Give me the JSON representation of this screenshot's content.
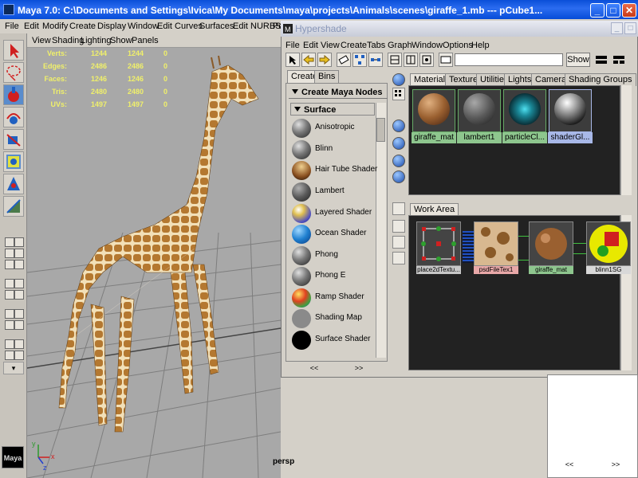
{
  "main_window": {
    "title": "Maya 7.0: C:\\Documents and Settings\\Ivica\\My Documents\\maya\\projects\\Animals\\scenes\\giraffe_1.mb   ---   pCube1...",
    "min": "_",
    "max": "□",
    "close": "✕"
  },
  "main_menu": [
    "File",
    "Edit",
    "Modify",
    "Create",
    "Display",
    "Window",
    "Edit Curves",
    "Surfaces",
    "Edit NURBS",
    "Po"
  ],
  "viewport": {
    "menu": [
      "View",
      "Shading",
      "Lighting",
      "Show",
      "Panels"
    ],
    "hud": [
      {
        "label": "Verts:",
        "v1": "1244",
        "v2": "1244",
        "v3": "0"
      },
      {
        "label": "Edges:",
        "v1": "2486",
        "v2": "2486",
        "v3": "0"
      },
      {
        "label": "Faces:",
        "v1": "1246",
        "v2": "1246",
        "v3": "0"
      },
      {
        "label": "Tris:",
        "v1": "2480",
        "v2": "2480",
        "v3": "0"
      },
      {
        "label": "UVs:",
        "v1": "1497",
        "v2": "1497",
        "v3": "0"
      }
    ],
    "camera_label": "persp",
    "logo_text": "Maya",
    "axis_x": "x",
    "axis_y": "y",
    "axis_z": "z"
  },
  "hypershade": {
    "title": "Hypershade",
    "menu": [
      "File",
      "Edit",
      "View",
      "Create",
      "Tabs",
      "Graph",
      "Window",
      "Options",
      "Help"
    ],
    "show_button": "Show",
    "left_tabs": [
      "Create",
      "Bins"
    ],
    "create_header": "Create Maya Nodes",
    "surface_header": "Surface",
    "nodes": [
      "Anisotropic",
      "Blinn",
      "Hair Tube Shader",
      "Lambert",
      "Layered Shader",
      "Ocean Shader",
      "Phong",
      "Phong E",
      "Ramp Shader",
      "Shading Map",
      "Surface Shader"
    ],
    "top_tabs": [
      "Materials",
      "Textures",
      "Utilities",
      "Lights",
      "Cameras",
      "Shading Groups"
    ],
    "materials": [
      {
        "name": "giraffe_mat",
        "color": "#b07a4a"
      },
      {
        "name": "lambert1",
        "color": "#8a8a8a"
      },
      {
        "name": "particleCl...",
        "color": "#1aa8b8"
      },
      {
        "name": "shaderGl...",
        "color": "#d8d8d8"
      }
    ],
    "work_area_tab": "Work Area",
    "work_nodes": [
      {
        "name": "place2dTextu...",
        "color": "#c8c8c8"
      },
      {
        "name": "psdFileTex1",
        "color": "#e8a8a8"
      },
      {
        "name": "giraffe_mat",
        "color": "#8ec68e"
      },
      {
        "name": "blinn1SG",
        "color": "#d8d8d8"
      }
    ],
    "scroll_left": "<<",
    "scroll_right": ">>"
  },
  "colors": {
    "title_blue": "#0a4fd8",
    "viewport_bg": "#a8a8a8",
    "hud_yellow": "#f0f06a",
    "material_label_green": "#8ec68e",
    "selected_label": "#a8b8e8",
    "work_area_bg": "#222222"
  }
}
